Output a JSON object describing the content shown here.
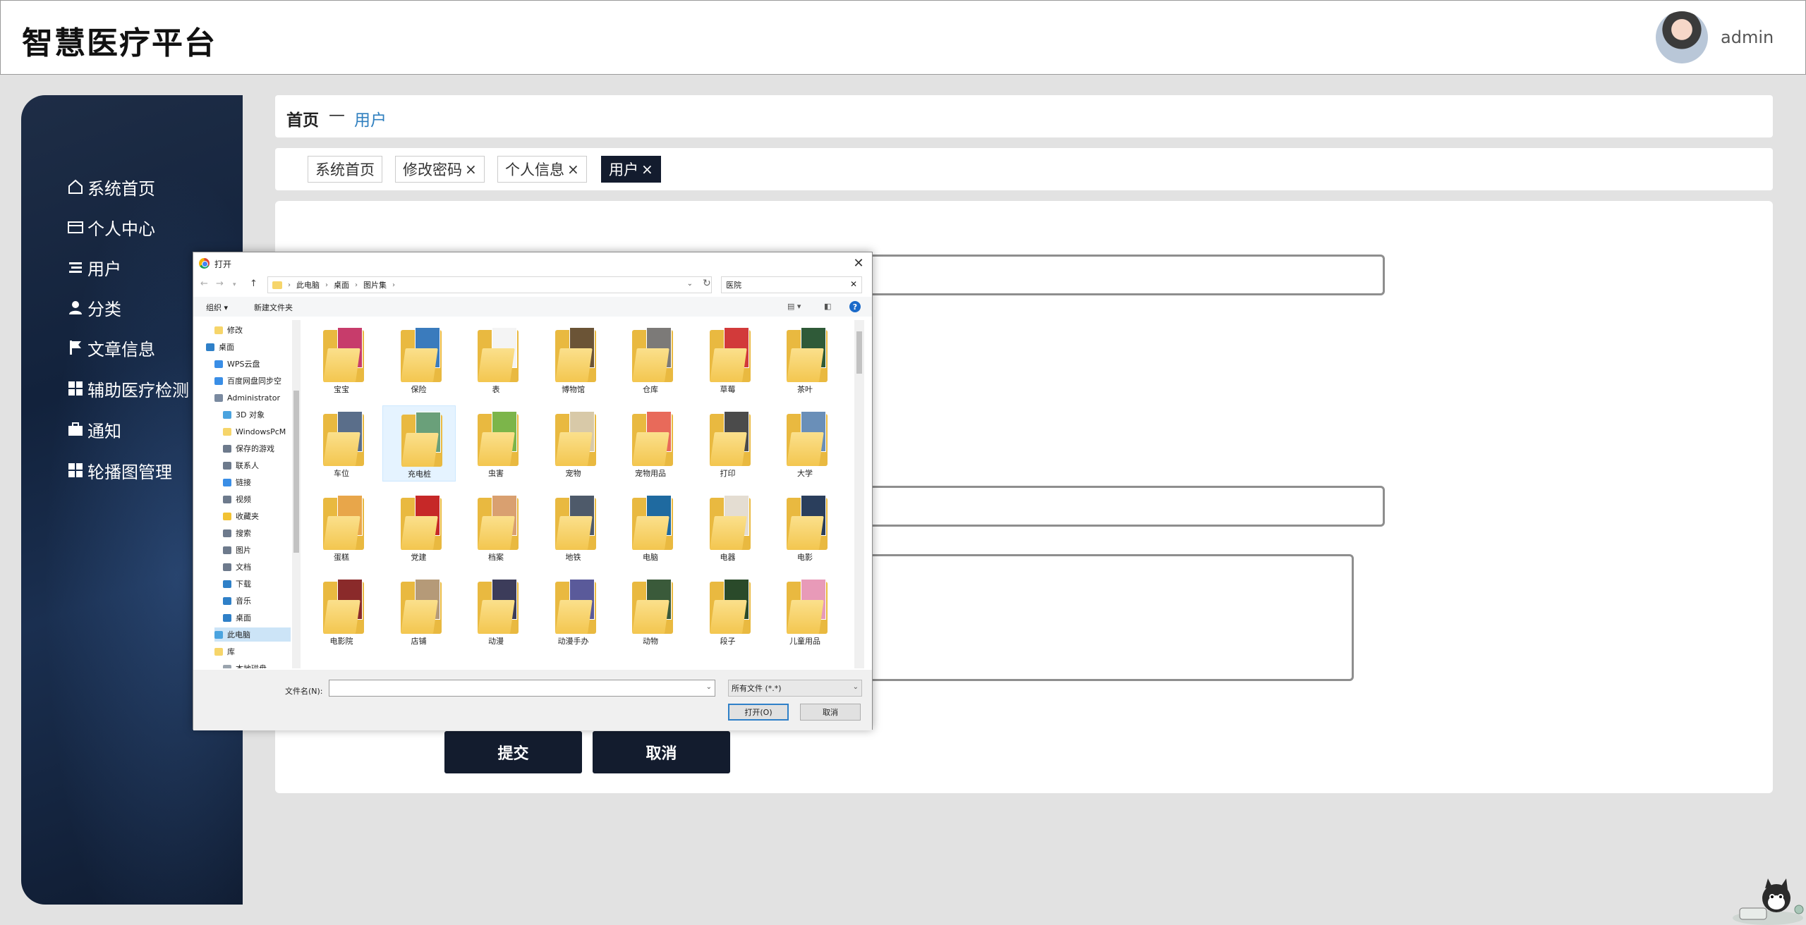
{
  "header": {
    "brand": "智慧医疗平台",
    "username": "admin"
  },
  "sidebar": {
    "items": [
      {
        "label": "系统首页",
        "icon": "home-icon"
      },
      {
        "label": "个人中心",
        "icon": "card-icon"
      },
      {
        "label": "用户",
        "icon": "list-icon"
      },
      {
        "label": "分类",
        "icon": "user-icon"
      },
      {
        "label": "文章信息",
        "icon": "flag-icon"
      },
      {
        "label": "辅助医疗检测",
        "icon": "grid-icon"
      },
      {
        "label": "通知",
        "icon": "briefcase-icon"
      },
      {
        "label": "轮播图管理",
        "icon": "grid-icon"
      }
    ]
  },
  "breadcrumb": {
    "home": "首页",
    "separator": "—",
    "current": "用户"
  },
  "tabs": [
    {
      "label": "系统首页",
      "closable": false,
      "active": false
    },
    {
      "label": "修改密码",
      "closable": true,
      "active": false
    },
    {
      "label": "个人信息",
      "closable": true,
      "active": false
    },
    {
      "label": "用户",
      "closable": true,
      "active": true
    }
  ],
  "tab_close_glyph": "×",
  "form": {
    "submit_label": "提交",
    "cancel_label": "取消"
  },
  "dialog": {
    "title": "打开",
    "close_glyph": "✕",
    "address": [
      "此电脑",
      "桌面",
      "图片集"
    ],
    "search_value": "医院",
    "commands": {
      "organize": "组织 ▾",
      "new_folder": "新建文件夹"
    },
    "tree": [
      {
        "label": "修改",
        "color": "#f6d56a"
      },
      {
        "label": "桌面",
        "color": "#2f80c8"
      },
      {
        "label": "WPS云盘",
        "color": "#3a8ee6"
      },
      {
        "label": "百度网盘同步空",
        "color": "#3a8ee6"
      },
      {
        "label": "Administrator",
        "color": "#7a8aa0"
      },
      {
        "label": "3D 对象",
        "color": "#4aa3df"
      },
      {
        "label": "WindowsPcM",
        "color": "#f6d56a"
      },
      {
        "label": "保存的游戏",
        "color": "#6d7a8c"
      },
      {
        "label": "联系人",
        "color": "#6d7a8c"
      },
      {
        "label": "链接",
        "color": "#3a8ee6"
      },
      {
        "label": "视频",
        "color": "#6d7a8c"
      },
      {
        "label": "收藏夹",
        "color": "#f2c233"
      },
      {
        "label": "搜索",
        "color": "#6d7a8c"
      },
      {
        "label": "图片",
        "color": "#6d7a8c"
      },
      {
        "label": "文档",
        "color": "#6d7a8c"
      },
      {
        "label": "下载",
        "color": "#2f80c8"
      },
      {
        "label": "音乐",
        "color": "#2f80c8"
      },
      {
        "label": "桌面",
        "color": "#2f80c8"
      },
      {
        "label": "此电脑",
        "color": "#4aa3df"
      },
      {
        "label": "库",
        "color": "#f6d56a"
      },
      {
        "label": "本地磁盘",
        "color": "#9aa4ae"
      }
    ],
    "files": [
      {
        "name": "宝宝",
        "color": "#c73c6b"
      },
      {
        "name": "保险",
        "color": "#3a7bbd"
      },
      {
        "name": "表",
        "color": "#f4f4f4"
      },
      {
        "name": "博物馆",
        "color": "#6b5436"
      },
      {
        "name": "仓库",
        "color": "#7c7a78"
      },
      {
        "name": "草莓",
        "color": "#d23a3a"
      },
      {
        "name": "茶叶",
        "color": "#2f5a38"
      },
      {
        "name": "车位",
        "color": "#5a6e8a"
      },
      {
        "name": "充电桩",
        "color": "#6aa07a"
      },
      {
        "name": "虫害",
        "color": "#7cb54a"
      },
      {
        "name": "宠物",
        "color": "#d8c9a8"
      },
      {
        "name": "宠物用品",
        "color": "#e86a5a"
      },
      {
        "name": "打印",
        "color": "#4b4b4b"
      },
      {
        "name": "大学",
        "color": "#6a8fb8"
      },
      {
        "name": "蛋糕",
        "color": "#e8a64a"
      },
      {
        "name": "党建",
        "color": "#c62828"
      },
      {
        "name": "档案",
        "color": "#d9a070"
      },
      {
        "name": "地铁",
        "color": "#4e5a6a"
      },
      {
        "name": "电脑",
        "color": "#1f6aa0"
      },
      {
        "name": "电器",
        "color": "#e4ddd2"
      },
      {
        "name": "电影",
        "color": "#2a3e5c"
      },
      {
        "name": "电影院",
        "color": "#8a2a2a"
      },
      {
        "name": "店铺",
        "color": "#b59a78"
      },
      {
        "name": "动漫",
        "color": "#3c3c5a"
      },
      {
        "name": "动漫手办",
        "color": "#5a5a9a"
      },
      {
        "name": "动物",
        "color": "#3a5a3a"
      },
      {
        "name": "段子",
        "color": "#2a4a2a"
      },
      {
        "name": "儿童用品",
        "color": "#e89ab8"
      }
    ],
    "filename_label": "文件名(N):",
    "filename_value": "",
    "filetype_value": "所有文件 (*.*)",
    "open_label": "打开(O)",
    "cancel_label": "取消"
  }
}
